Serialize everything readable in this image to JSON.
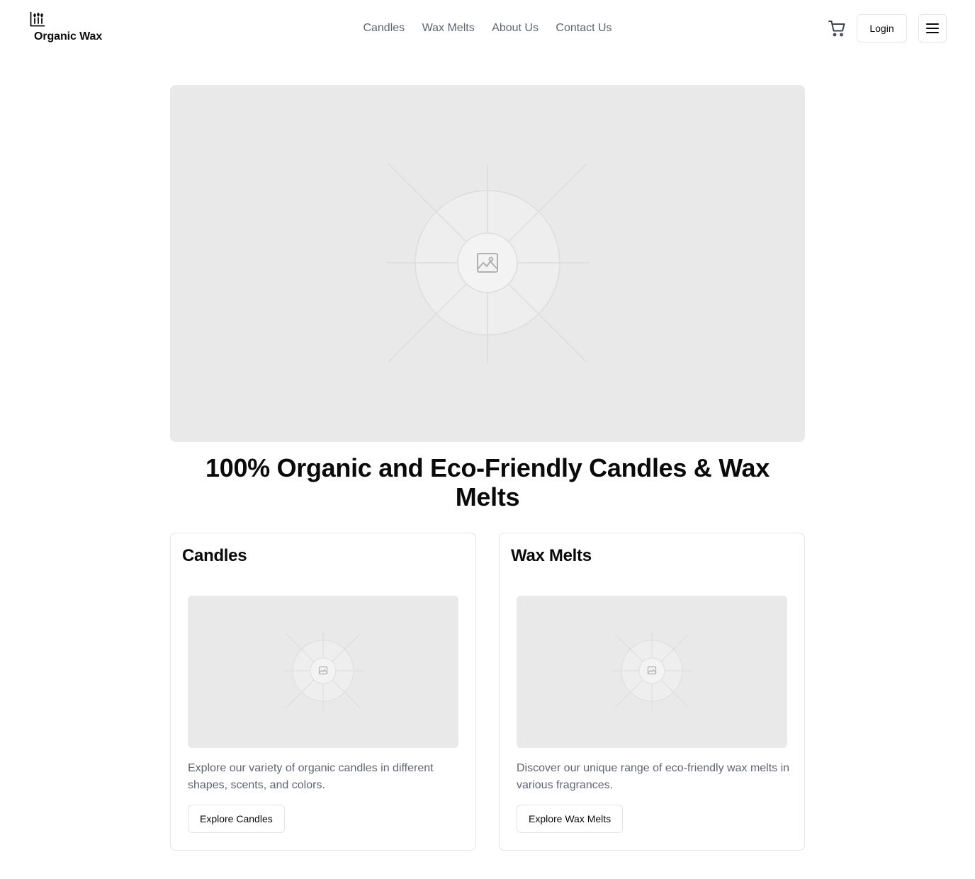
{
  "header": {
    "brand": "Organic Wax",
    "brand_icon": "candles-icon",
    "nav": [
      {
        "label": "Candles"
      },
      {
        "label": "Wax Melts"
      },
      {
        "label": "About Us"
      },
      {
        "label": "Contact Us"
      }
    ],
    "cart_icon": "shopping-cart-icon",
    "login_label": "Login",
    "menu_icon": "hamburger-menu-icon"
  },
  "hero": {
    "image_icon": "image-placeholder-icon",
    "title": "100% Organic and Eco-Friendly Candles & Wax Melts"
  },
  "cards": [
    {
      "title": "Candles",
      "image_icon": "image-placeholder-icon",
      "description": "Explore our variety of organic candles in different shapes, scents, and colors.",
      "button_label": "Explore Candles"
    },
    {
      "title": "Wax Melts",
      "image_icon": "image-placeholder-icon",
      "description": "Discover our unique range of eco-friendly wax melts in various fragrances.",
      "button_label": "Explore Wax Melts"
    }
  ],
  "colors": {
    "text": "#0a0a0a",
    "muted": "#5f6672",
    "border": "#e4e4e7",
    "placeholder_bg": "#e9e9e9"
  }
}
